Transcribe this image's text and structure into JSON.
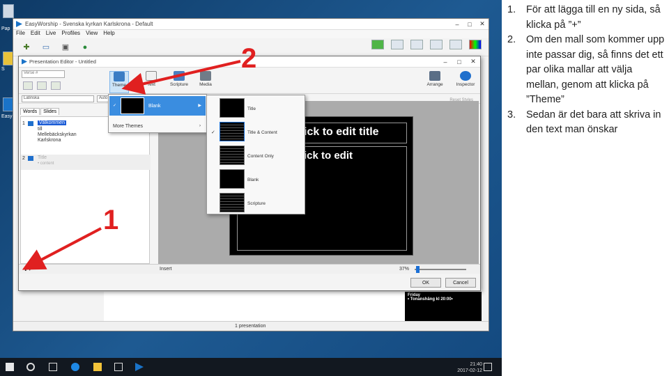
{
  "desktop": {
    "icon1_label": "Pap",
    "icon2_label": "S",
    "icon3_label": "Easy"
  },
  "easyworship": {
    "title": "EasyWorship - Svenska kyrkan Karlskrona - Default",
    "menu": [
      "File",
      "Edit",
      "Live",
      "Profiles",
      "View",
      "Help"
    ],
    "bottom_status": "1 presentation",
    "live_text": [
      "Friday",
      "• Tonanshäng kl 20:00•"
    ]
  },
  "editor": {
    "title": "Presentation Editor - Untitled",
    "search_placeholder": "Verse #",
    "ribbon": {
      "theme": "Theme",
      "text": "Text",
      "scripture": "Scripture",
      "media": "Media",
      "arrange": "Arrange",
      "inspector": "Inspector"
    },
    "font_select": "Latinska",
    "size_select": "Auto",
    "reset_styles": "Reset Styles",
    "tabs": [
      "Words",
      "Slides"
    ],
    "slides": [
      {
        "num": "1",
        "lines": [
          "Välkommen",
          "till",
          "Mellebäckskyrkan",
          "Karlskrona"
        ]
      },
      {
        "num": "2",
        "lines": [
          "Title",
          "• content"
        ]
      }
    ],
    "canvas_title": "ick to edit title",
    "canvas_body": "ick to edit",
    "status_insert": "Insert",
    "zoom": "37%",
    "ok": "OK",
    "cancel": "Cancel"
  },
  "theme_menu": {
    "blank": "Blank",
    "more_themes": "More Themes"
  },
  "layouts": [
    "Title",
    "Title & Content",
    "Content Only",
    "Blank",
    "Scripture"
  ],
  "annotations": {
    "one": "1",
    "two": "2"
  },
  "taskbar": {
    "time": "21:40",
    "date": "2017-02-12"
  },
  "instructions": [
    {
      "num": "1.",
      "text": "För att lägga till en ny sida, så klicka på ”+”"
    },
    {
      "num": "2.",
      "text": "Om den mall som kommer upp inte passar dig, så finns det ett par olika mallar att välja mellan, genom att klicka på ”Theme”"
    },
    {
      "num": "3.",
      "text": "Sedan är det bara att skriva in den text man önskar"
    }
  ]
}
